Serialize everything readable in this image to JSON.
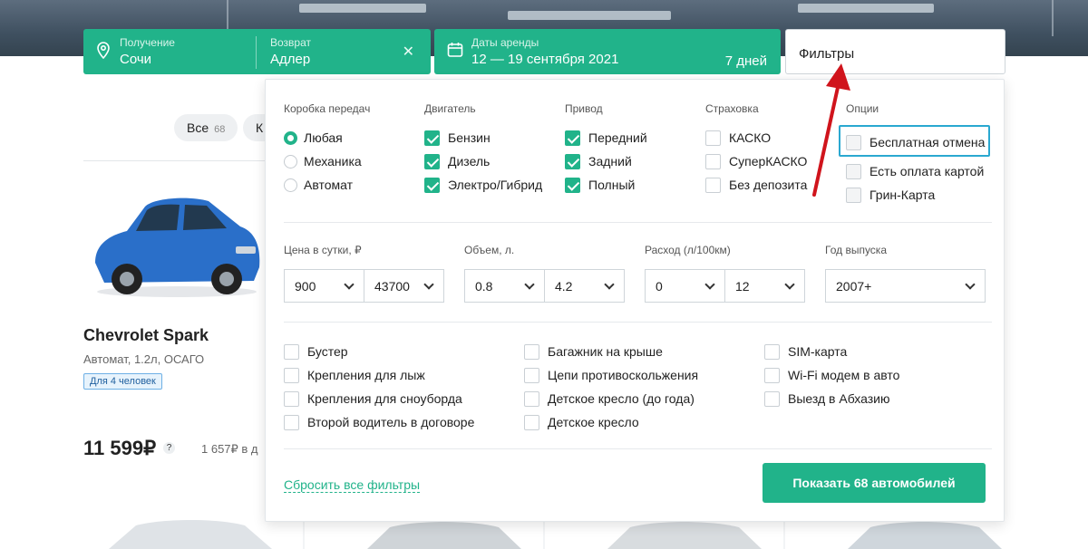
{
  "search": {
    "pickup_caption": "Получение",
    "pickup_value": "Сочи",
    "dropoff_caption": "Возврат",
    "dropoff_value": "Адлер",
    "dates_caption": "Даты аренды",
    "dates_value": "12 — 19 сентября 2021",
    "days": "7 дней",
    "filters_label": "Фильтры"
  },
  "chips": [
    {
      "label": "Все",
      "count": "68"
    },
    {
      "label": "К"
    }
  ],
  "car": {
    "name": "Chevrolet Spark",
    "spec": "Автомат, 1.2л, ОСАГО",
    "badge": "Для 4 человек",
    "price": "11 599₽",
    "help": "?",
    "per_day": "1 657₽ в д"
  },
  "filters": {
    "transmission": {
      "title": "Коробка передач",
      "options": [
        {
          "label": "Любая",
          "selected": true
        },
        {
          "label": "Механика",
          "selected": false
        },
        {
          "label": "Автомат",
          "selected": false
        }
      ]
    },
    "engine": {
      "title": "Двигатель",
      "options": [
        {
          "label": "Бензин",
          "checked": true
        },
        {
          "label": "Дизель",
          "checked": true
        },
        {
          "label": "Электро/Гибрид",
          "checked": true
        }
      ]
    },
    "drive": {
      "title": "Привод",
      "options": [
        {
          "label": "Передний",
          "checked": true
        },
        {
          "label": "Задний",
          "checked": true
        },
        {
          "label": "Полный",
          "checked": true
        }
      ]
    },
    "insurance": {
      "title": "Страховка",
      "options": [
        {
          "label": "КАСКО",
          "checked": false
        },
        {
          "label": "СуперКАСКО",
          "checked": false
        },
        {
          "label": "Без депозита",
          "checked": false
        }
      ]
    },
    "options": {
      "title": "Опции",
      "options": [
        {
          "label": "Бесплатная отмена",
          "checked": false
        },
        {
          "label": "Есть оплата картой",
          "checked": false
        },
        {
          "label": "Грин-Карта",
          "checked": false
        }
      ]
    },
    "ranges": [
      {
        "label": "Цена в сутки, ₽",
        "from": "900",
        "to": "43700"
      },
      {
        "label": "Объем, л.",
        "from": "0.8",
        "to": "4.2"
      },
      {
        "label": "Расход (л/100км)",
        "from": "0",
        "to": "12"
      }
    ],
    "year": {
      "label": "Год выпуска",
      "value": "2007+"
    },
    "extras": [
      "Бустер",
      "Крепления для лыж",
      "Крепления для сноуборда",
      "Второй водитель в договоре",
      "Багажник на крыше",
      "Цепи противоскольжения",
      "Детское кресло (до года)",
      "Детское кресло",
      "SIM-карта",
      "Wi-Fi модем в авто",
      "Выезд в Абхазию"
    ],
    "reset_label": "Сбросить все фильтры",
    "show_label": "Показать 68 автомобилей"
  },
  "colors": {
    "accent": "#21b38a",
    "highlight": "#2aa8d0",
    "arrow": "#d0141c"
  }
}
